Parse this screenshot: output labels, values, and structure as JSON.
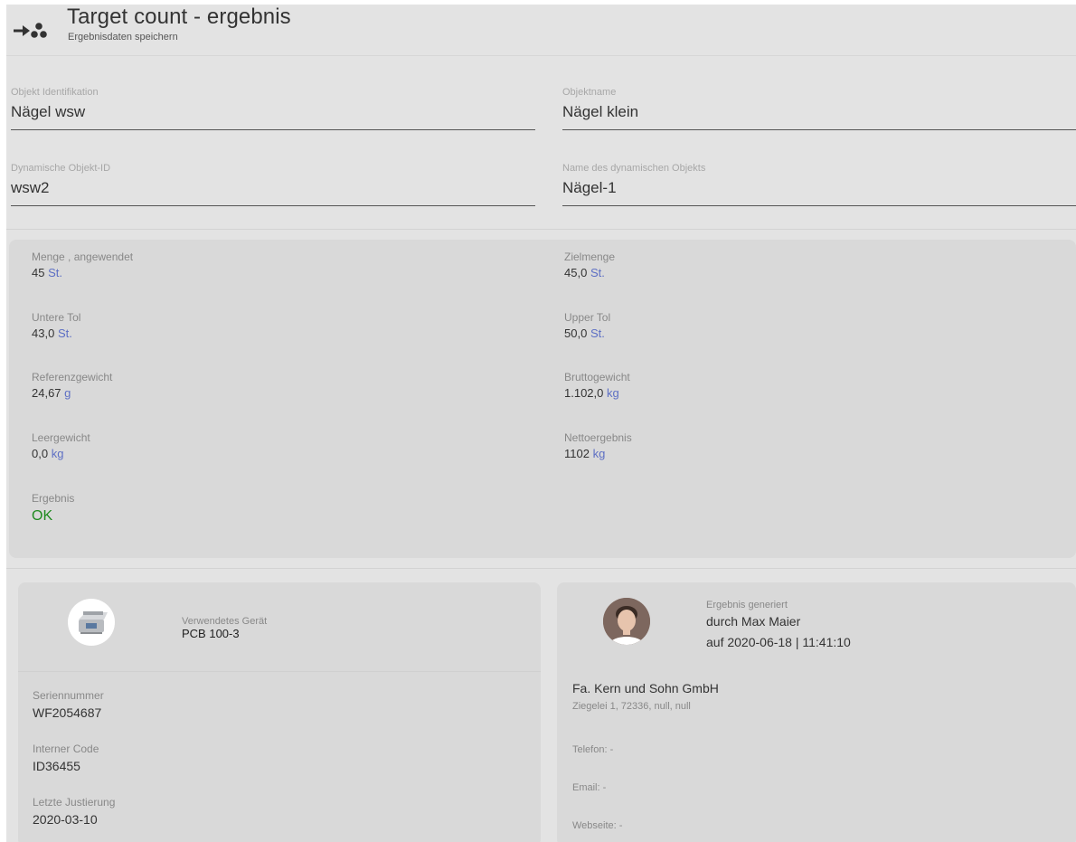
{
  "header": {
    "title": "Target count - ergebnis",
    "subtitle": "Ergebnisdaten speichern",
    "icon": "target-count-icon"
  },
  "form": {
    "object_id": {
      "label": "Objekt Identifikation",
      "value": "Nägel wsw"
    },
    "object_name": {
      "label": "Objektname",
      "value": "Nägel klein"
    },
    "dynamic_id": {
      "label": "Dynamische Objekt-ID",
      "value": "wsw2"
    },
    "dynamic_name": {
      "label": "Name des dynamischen Objekts",
      "value": "Nägel-1"
    }
  },
  "results": {
    "quantity_applied": {
      "label": "Menge , angewendet",
      "value": "45",
      "unit": "St."
    },
    "target_quantity": {
      "label": "Zielmenge",
      "value": "45,0",
      "unit": "St."
    },
    "lower_tol": {
      "label": "Untere Tol",
      "value": "43,0",
      "unit": "St."
    },
    "upper_tol": {
      "label": "Upper Tol",
      "value": "50,0",
      "unit": "St."
    },
    "reference_weight": {
      "label": "Referenzgewicht",
      "value": "24,67",
      "unit": "g"
    },
    "gross_weight": {
      "label": "Bruttogewicht",
      "value": "1.102,0",
      "unit": "kg"
    },
    "tare_weight": {
      "label": "Leergewicht",
      "value": "0,0",
      "unit": "kg"
    },
    "net_result": {
      "label": "Nettoergebnis",
      "value": "1102",
      "unit": "kg"
    },
    "result": {
      "label": "Ergebnis",
      "value": "OK"
    }
  },
  "device": {
    "label": "Verwendetes Gerät",
    "value": "PCB 100-3",
    "serial": {
      "label": "Seriennummer",
      "value": "WF2054687"
    },
    "internal_code": {
      "label": "Interner Code",
      "value": "ID36455"
    },
    "last_calibration": {
      "label": "Letzte Justierung",
      "value": "2020-03-10"
    }
  },
  "generated": {
    "label": "Ergebnis generiert",
    "by": "durch Max Maier",
    "at": "auf 2020-06-18 | 11:41:10",
    "company": "Fa. Kern und Sohn GmbH",
    "address": "Ziegelei 1, 72336, null, null",
    "phone": "Telefon: -",
    "email": "Email: -",
    "website": "Webseite: -"
  },
  "colors": {
    "background": "#e3e3e3",
    "panel": "#d9d9d9",
    "unit": "#5d6fc4",
    "ok": "#1f8a1f"
  }
}
